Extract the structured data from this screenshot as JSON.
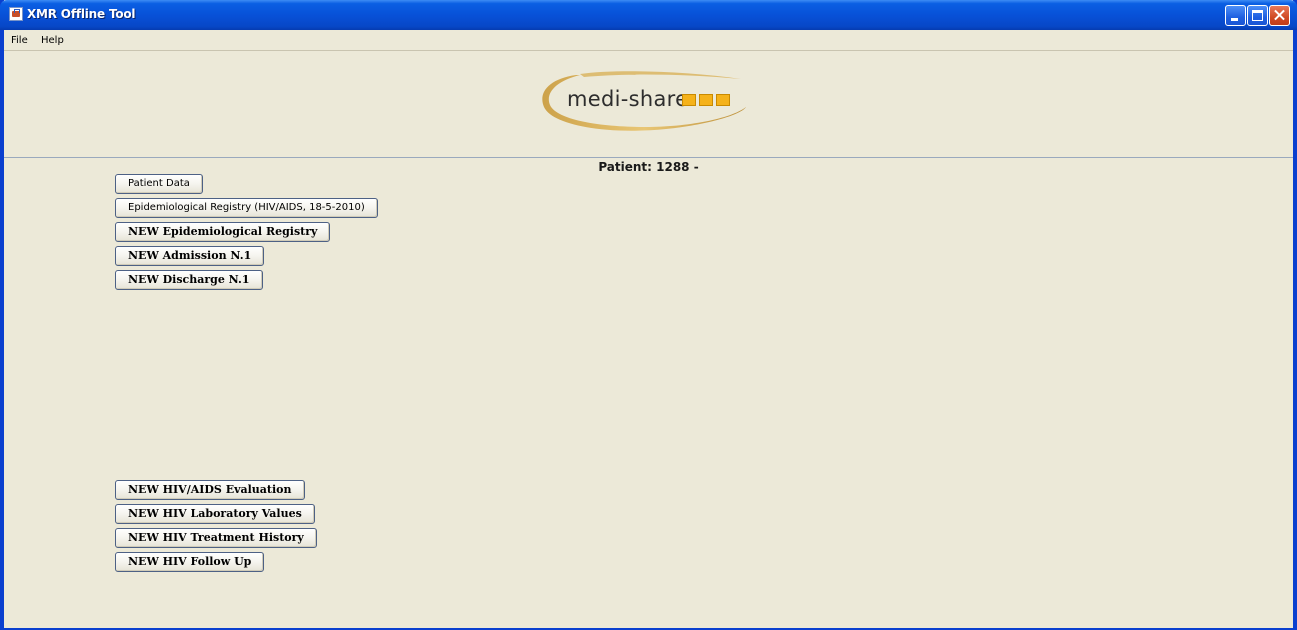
{
  "window": {
    "title": "XMR Offline Tool",
    "icon": "java-cup-icon",
    "controls": [
      "minimize",
      "maximize",
      "close"
    ]
  },
  "menu": {
    "items": [
      "File",
      "Help"
    ]
  },
  "logo": {
    "text": "medi-share",
    "accent_color": "#f5b21a"
  },
  "patient": {
    "label": "Patient: 1288 -"
  },
  "buttons": {
    "patient_data": "Patient Data",
    "epi_registry": "Epidemiological Registry  (HIV/AIDS, 18-5-2010)",
    "new_epi_registry": "NEW Epidemiological Registry",
    "new_admission": "NEW Admission N.1",
    "new_discharge": "NEW Discharge N.1",
    "new_hiv_eval": "NEW HIV/AIDS Evaluation",
    "new_hiv_lab": "NEW HIV Laboratory Values",
    "new_hiv_treatment": "NEW HIV Treatment History",
    "new_hiv_followup": "NEW HIV Follow Up"
  }
}
